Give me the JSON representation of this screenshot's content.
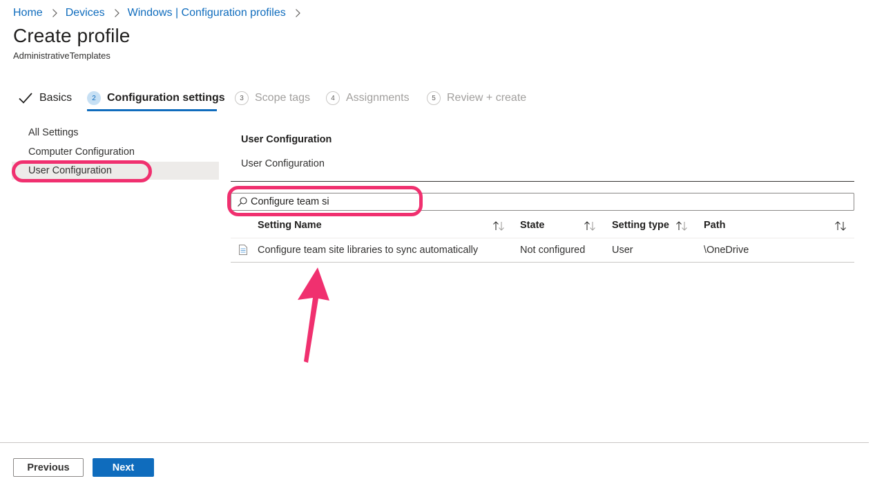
{
  "breadcrumb": {
    "items": [
      "Home",
      "Devices",
      "Windows | Configuration profiles"
    ]
  },
  "page": {
    "title": "Create profile",
    "subtitle": "AdministrativeTemplates"
  },
  "wizard": {
    "steps": [
      {
        "number": "",
        "label": "Basics",
        "state": "done"
      },
      {
        "number": "2",
        "label": "Configuration settings",
        "state": "current"
      },
      {
        "number": "3",
        "label": "Scope tags",
        "state": "future"
      },
      {
        "number": "4",
        "label": "Assignments",
        "state": "future"
      },
      {
        "number": "5",
        "label": "Review + create",
        "state": "future"
      }
    ]
  },
  "leftnav": {
    "items": [
      "All Settings",
      "Computer Configuration",
      "User Configuration"
    ],
    "selected": "User Configuration"
  },
  "content": {
    "section_title": "User Configuration",
    "section_subtitle": "User Configuration",
    "search": {
      "value": "Configure team si",
      "icon": "search-icon"
    },
    "columns": [
      "Setting Name",
      "State",
      "Setting type",
      "Path"
    ],
    "rows": [
      {
        "icon": "document-icon",
        "setting_name": "Configure team site libraries to sync automatically",
        "state": "Not configured",
        "setting_type": "User",
        "path": "\\OneDrive"
      }
    ]
  },
  "footer": {
    "previous_label": "Previous",
    "next_label": "Next"
  },
  "colors": {
    "accent": "#0f6cbd",
    "annotation": "#f0306f",
    "selected_nav": "#edebe9"
  }
}
